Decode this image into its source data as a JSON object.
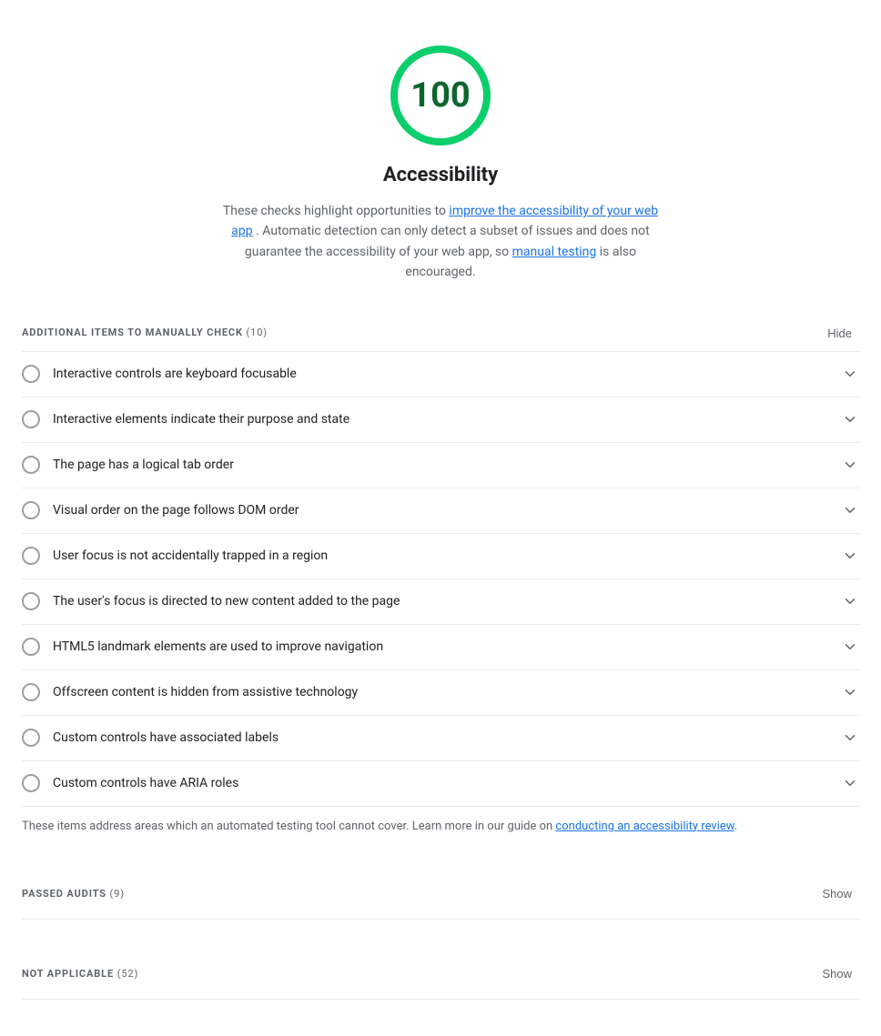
{
  "score": {
    "value": "100",
    "color": "#0cce6b",
    "number_color": "#0d652d",
    "title": "Accessibility",
    "description_parts": [
      "These checks highlight opportunities to ",
      "improve the accessibility of your web app",
      ". Automatic detection can only detect a subset of issues and does not guarantee the accessibility of your web app, so ",
      "manual testing",
      " is also encouraged."
    ],
    "improve_link_text": "improve the accessibility of your web app",
    "manual_link_text": "manual testing"
  },
  "manual_section": {
    "label": "ADDITIONAL ITEMS TO MANUALLY CHECK",
    "count": "10",
    "toggle_label": "Hide",
    "items": [
      {
        "id": "keyboard-focusable",
        "text": "Interactive controls are keyboard focusable"
      },
      {
        "id": "interactive-elements",
        "text": "Interactive elements indicate their purpose and state"
      },
      {
        "id": "tab-order",
        "text": "The page has a logical tab order"
      },
      {
        "id": "dom-order",
        "text": "Visual order on the page follows DOM order"
      },
      {
        "id": "focus-trap",
        "text": "User focus is not accidentally trapped in a region"
      },
      {
        "id": "focus-directed",
        "text": "The user's focus is directed to new content added to the page"
      },
      {
        "id": "landmark-elements",
        "text": "HTML5 landmark elements are used to improve navigation"
      },
      {
        "id": "offscreen-content",
        "text": "Offscreen content is hidden from assistive technology"
      },
      {
        "id": "custom-labels",
        "text": "Custom controls have associated labels"
      },
      {
        "id": "aria-roles",
        "text": "Custom controls have ARIA roles"
      }
    ],
    "footer_text_parts": [
      "These items address areas which an automated testing tool cannot cover. Learn more in our guide on ",
      "conducting an accessibility review",
      "."
    ],
    "conducting_link_text": "conducting an accessibility review"
  },
  "passed_section": {
    "label": "PASSED AUDITS",
    "count": "9",
    "toggle_label": "Show"
  },
  "not_applicable_section": {
    "label": "NOT APPLICABLE",
    "count": "52",
    "toggle_label": "Show"
  }
}
